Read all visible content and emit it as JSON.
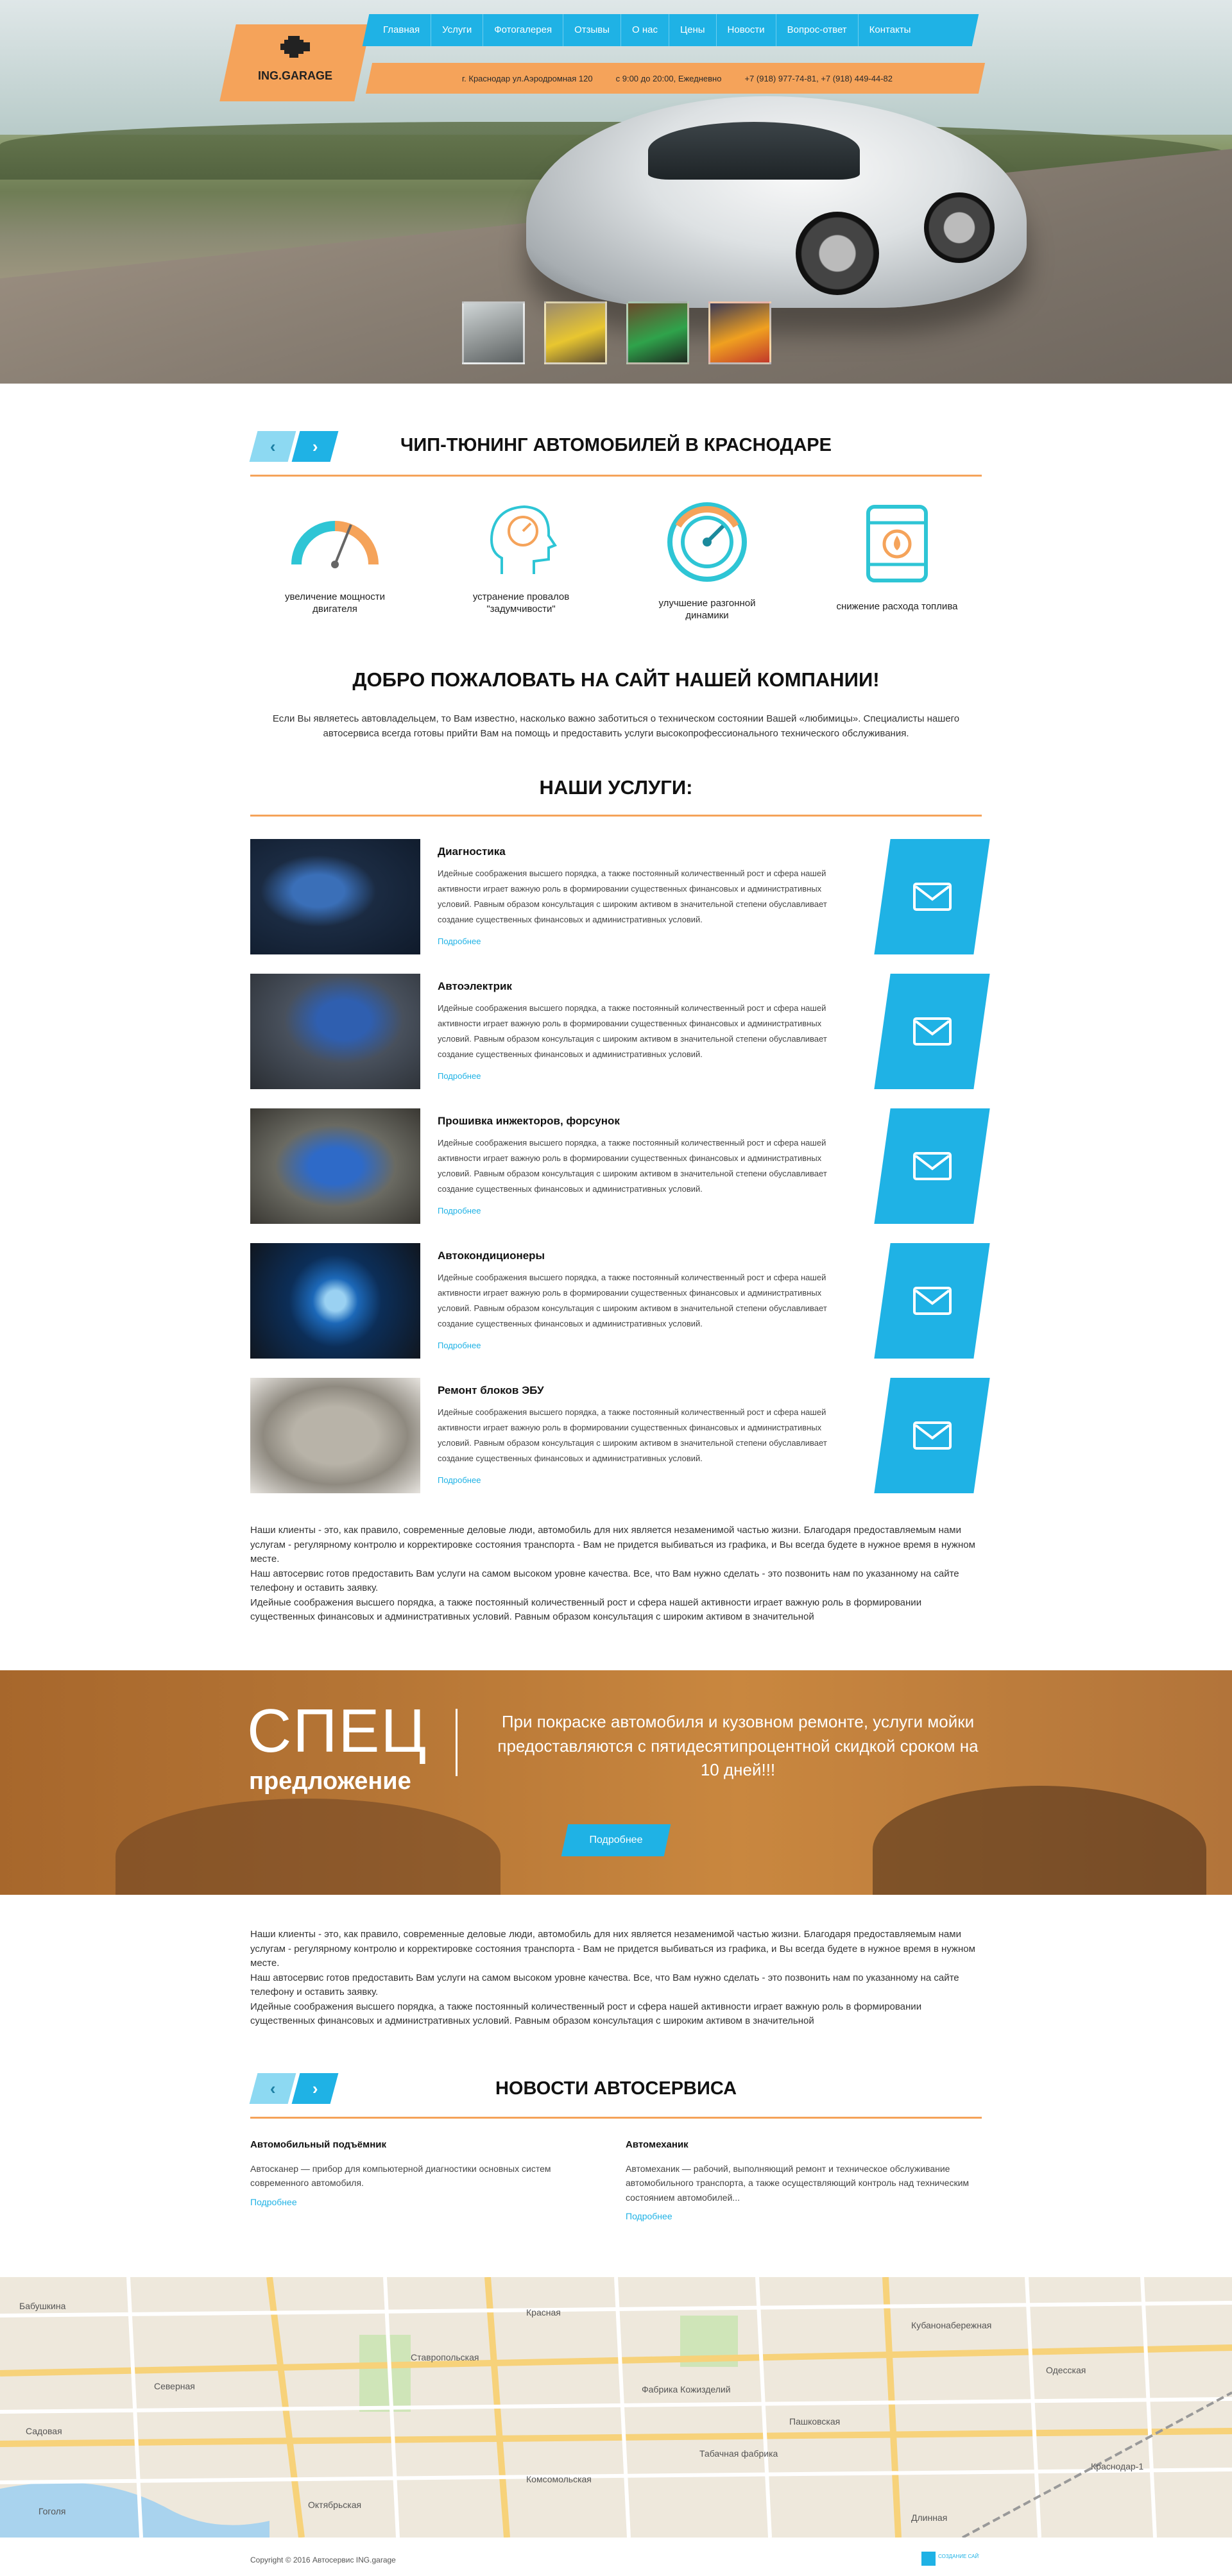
{
  "brand": {
    "name": "ING.GARAGE"
  },
  "nav": [
    "Главная",
    "Услуги",
    "Фотогалерея",
    "Отзывы",
    "О нас",
    "Цены",
    "Новости",
    "Вопрос-ответ",
    "Контакты"
  ],
  "info": {
    "address": "г. Краснодар ул.Аэродромная 120",
    "hours": "с 9:00 до 20:00, Ежедневно",
    "phones": "+7 (918) 977-74-81, +7 (918) 449-44-82"
  },
  "tuning": {
    "title": "ЧИП-ТЮНИНГ АВТОМОБИЛЕЙ В КРАСНОДАРЕ",
    "features": [
      {
        "label": "увеличение мощности двигателя",
        "icon": "speedometer-icon"
      },
      {
        "label": "устранение провалов \"задумчивости\"",
        "icon": "head-gauge-icon"
      },
      {
        "label": "улучшение разгонной динамики",
        "icon": "dial-icon"
      },
      {
        "label": "снижение расхода топлива",
        "icon": "fuel-canister-icon"
      }
    ]
  },
  "welcome": {
    "title": "ДОБРО ПОЖАЛОВАТЬ НА САЙТ НАШЕЙ КОМПАНИИ!",
    "text": "Если Вы являетесь автовладельцем, то Вам известно, насколько важно заботиться о техническом состоянии Вашей «любимицы». Специалисты нашего автосервиса всегда готовы прийти Вам на помощь и предоставить услуги высокопрофессионального технического обслуживания."
  },
  "services": {
    "title": "НАШИ УСЛУГИ:",
    "more_label": "Подробнее",
    "items": [
      {
        "title": "Диагностика",
        "text": "Идейные соображения высшего порядка, а также постоянный количественный рост и сфера нашей активности играет важную роль в формировании существенных финансовых и административных условий. Равным образом консультация с широким активом в значительной степени обуславливает создание существенных финансовых и административных условий."
      },
      {
        "title": "Автоэлектрик",
        "text": "Идейные соображения высшего порядка, а также постоянный количественный рост и сфера нашей активности играет важную роль в формировании существенных финансовых и административных условий. Равным образом консультация с широким активом в значительной степени обуславливает создание существенных финансовых и административных условий."
      },
      {
        "title": "Прошивка инжекторов, форсунок",
        "text": "Идейные соображения высшего порядка, а также постоянный количественный рост и сфера нашей активности играет важную роль в формировании существенных финансовых и административных условий. Равным образом консультация с широким активом в значительной степени обуславливает создание существенных финансовых и административных условий."
      },
      {
        "title": "Автокондиционеры",
        "text": "Идейные соображения высшего порядка, а также постоянный количественный рост и сфера нашей активности играет важную роль в формировании существенных финансовых и административных условий. Равным образом консультация с широким активом в значительной степени обуславливает создание существенных финансовых и административных условий."
      },
      {
        "title": "Ремонт блоков ЭБУ",
        "text": "Идейные соображения высшего порядка, а также постоянный количественный рост и сфера нашей активности играет важную роль в формировании существенных финансовых и административных условий. Равным образом консультация с широким активом в значительной степени обуславливает создание существенных финансовых и административных условий."
      }
    ]
  },
  "clients_text": "Наши клиенты - это, как правило, современные деловые люди, автомобиль для них является незаменимой частью жизни. Благодаря предоставляемым нами услугам - регулярному контролю и корректировке состояния транспорта - Вам не придется выбиваться из графика, и Вы всегда будете в нужное время в нужном месте.\nНаш автосервис готов предоставить Вам услуги на самом высоком уровне качества. Все, что Вам нужно сделать - это позвонить нам по указанному на сайте телефону и оставить заявку.\nИдейные соображения высшего порядка, а также постоянный количественный рост и сфера нашей активности играет важную роль в формировании существенных финансовых и административных условий. Равным образом консультация с широким активом в значительной",
  "promo": {
    "big": "СПЕЦ",
    "sub": "предложение",
    "text": "При покраске автомобиля и кузовном ремонте, услуги мойки предоставляются с пятидесятипроцентной скидкой сроком на 10 дней!!!",
    "button": "Подробнее"
  },
  "news": {
    "title": "НОВОСТИ АВТОСЕРВИСА",
    "items": [
      {
        "title": "Автомобильный подъёмник",
        "text": "Автосканер — прибор для компьютерной диагностики основных систем современного автомобиля.",
        "more": "Подробнее"
      },
      {
        "title": "Автомеханик",
        "text": "Автомеханик — рабочий, выполняющий ремонт и техническое обслуживание автомобильного транспорта, а также осуществляющий контроль над техническим состоянием автомобилей...",
        "more": "Подробнее"
      }
    ]
  },
  "map": {
    "labels": [
      "Бабушкина",
      "Северная",
      "Садовая",
      "Фабрика Кожизделий",
      "Табачная фабрика",
      "Ставропольская",
      "Комсомольская",
      "Кубанонабережная",
      "Пашковская",
      "Гоголя",
      "Октябрьская",
      "Одесская",
      "Длинная",
      "Красная",
      "Краснодар-1"
    ]
  },
  "footer": {
    "copyright": "Copyright © 2016 Автосервис ING.garage",
    "dev_logo": "СОЗДАНИЕ САЙТА"
  },
  "colors": {
    "accent": "#1fb2e5",
    "orange": "#f5a35a"
  }
}
